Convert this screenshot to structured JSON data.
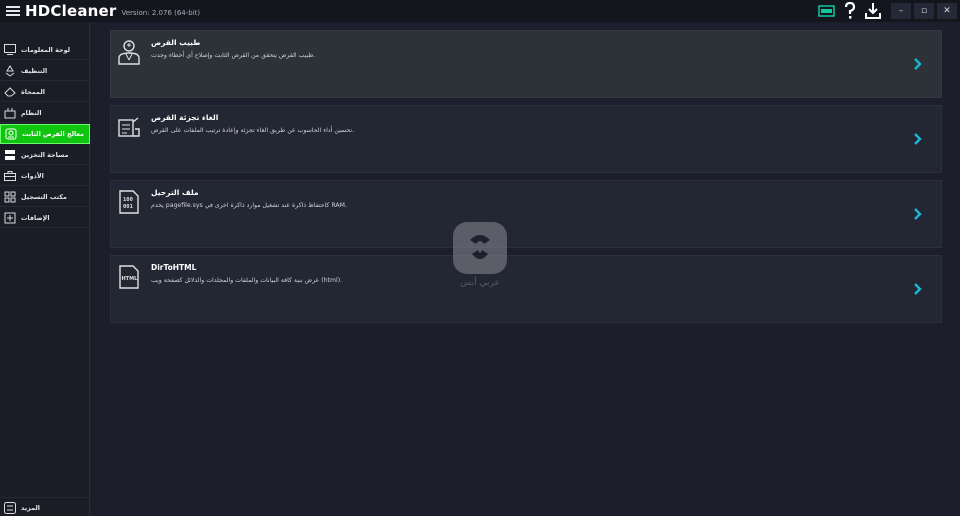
{
  "app": {
    "name": "HDCleaner",
    "version": "Version: 2.076 (64-bit)"
  },
  "titlebar": {
    "icons": [
      "battery-icon",
      "help-icon",
      "download-icon"
    ],
    "controls": [
      "minimize",
      "restore",
      "close"
    ],
    "minimize_glyph": "–",
    "restore_glyph": "▫",
    "close_glyph": "✕"
  },
  "sidebar": {
    "items": [
      {
        "label": "لوحة المعلومات",
        "icon": "dashboard-icon",
        "active": false
      },
      {
        "label": "التنظيف",
        "icon": "recycle-icon",
        "active": false
      },
      {
        "label": "الممحاة",
        "icon": "eraser-icon",
        "active": false
      },
      {
        "label": "النظام",
        "icon": "system-icon",
        "active": false
      },
      {
        "label": "معالج القرص الثابت",
        "icon": "disk-doctor-icon",
        "active": true
      },
      {
        "label": "مساحة التخزين",
        "icon": "storage-icon",
        "active": false
      },
      {
        "label": "الأدوات",
        "icon": "toolbox-icon",
        "active": false
      },
      {
        "label": "مكتب التسجيل",
        "icon": "registry-icon",
        "active": false
      },
      {
        "label": "الإضافات",
        "icon": "addons-icon",
        "active": false
      }
    ],
    "more_label": "المزيد"
  },
  "cards": [
    {
      "title": "طبيب القرص",
      "desc": "طبيب القرص يتحقق من القرص الثابت وإصلاح أي أخطاء وجدت.",
      "icon": "disk-doctor-icon",
      "highlighted": true
    },
    {
      "title": "الغاء تجزئة القرص",
      "desc": "تحسين أداء الحاسوب عن طريق الغاء تجزئة وإعادة ترتيب الملفات على القرص.",
      "icon": "defrag-icon",
      "highlighted": false
    },
    {
      "title": "ملف الترحيل",
      "desc": "يخدم pagefile.sys كاحتفاظ ذاكرة عند تشغيل موارد ذاكرة اخرى في RAM.",
      "icon": "binary-file-icon",
      "highlighted": false
    },
    {
      "title": "DirToHTML",
      "desc": "عرض بنية كافة البيانات والملفات والمجلدات والدلائل كصفحة ويب (html).",
      "icon": "html-file-icon",
      "highlighted": false
    }
  ],
  "watermark": {
    "text": "عربي أبس"
  },
  "colors": {
    "accent_green": "#0fc50f",
    "arrow_cyan": "#1fb7d6",
    "background": "#1c1f2b",
    "card": "#232633"
  }
}
